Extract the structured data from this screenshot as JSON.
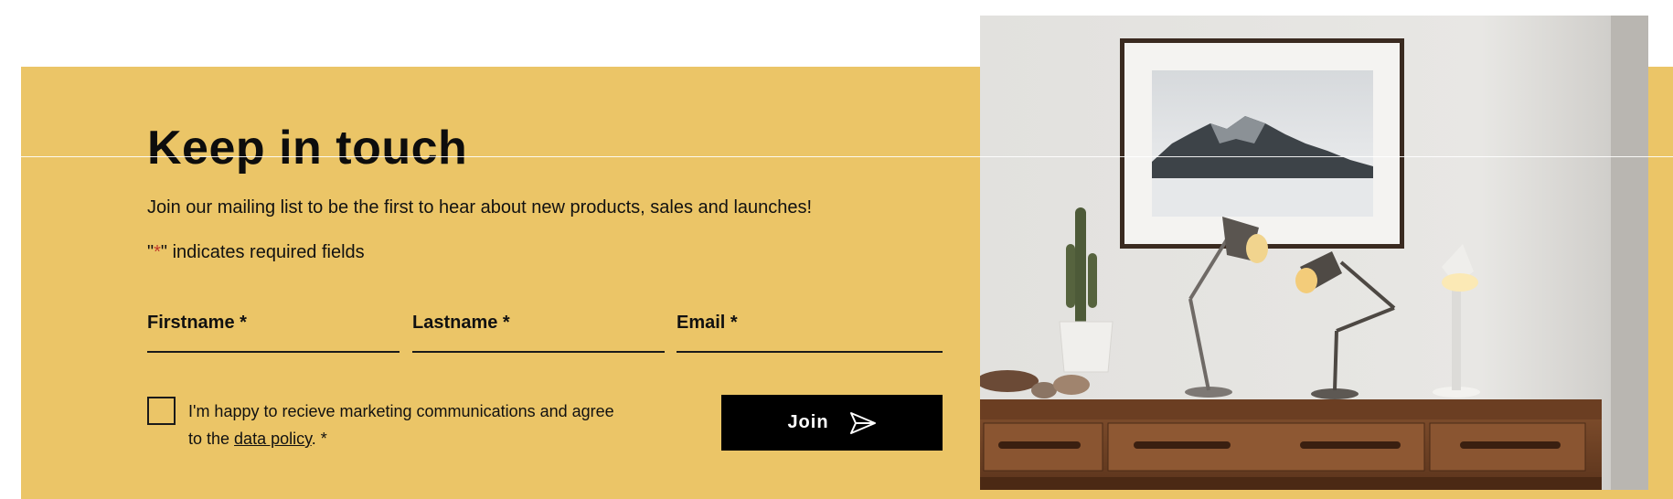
{
  "newsletter": {
    "title": "Keep in touch",
    "subtitle": "Join our mailing list to be the first to hear about new products, sales and launches!",
    "required_note": {
      "prefix": "\"",
      "star": "*",
      "suffix": "\" indicates required fields"
    },
    "fields": {
      "firstname": "Firstname *",
      "lastname": "Lastname *",
      "email": "Email *"
    },
    "consent": {
      "text_before": "I'm happy to recieve marketing communications and agree to the ",
      "link": "data policy",
      "text_after": ". *"
    },
    "join_label": "Join",
    "icons": {
      "join": "send-arrow-icon"
    }
  },
  "colors": {
    "panel": "#ebc567",
    "button": "#000000",
    "required_star": "#c0392b"
  },
  "photo": {
    "description_icon": "interior-photo-lamps-sideboard"
  }
}
